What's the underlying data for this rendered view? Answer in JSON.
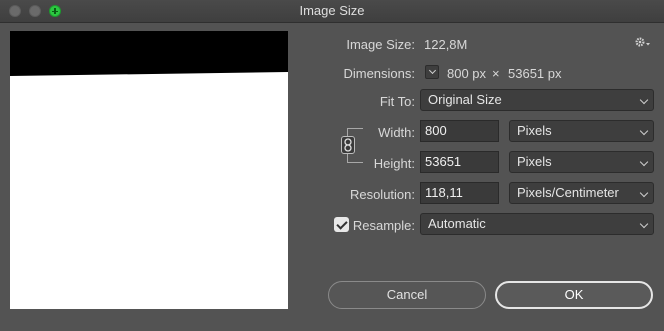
{
  "window": {
    "title": "Image Size"
  },
  "image_size": {
    "label": "Image Size:",
    "value": "122,8M"
  },
  "dimensions": {
    "label": "Dimensions:",
    "width": "800 px",
    "separator": "×",
    "height": "53651 px"
  },
  "fit_to": {
    "label": "Fit To:",
    "value": "Original Size"
  },
  "width": {
    "label": "Width:",
    "value": "800",
    "unit": "Pixels"
  },
  "height": {
    "label": "Height:",
    "value": "53651",
    "unit": "Pixels"
  },
  "resolution": {
    "label": "Resolution:",
    "value": "118,11",
    "unit": "Pixels/Centimeter"
  },
  "resample": {
    "label": "Resample:",
    "checked": true,
    "value": "Automatic"
  },
  "buttons": {
    "cancel": "Cancel",
    "ok": "OK"
  },
  "colors": {
    "background": "#535353",
    "zoom_button": "#2bc840"
  }
}
